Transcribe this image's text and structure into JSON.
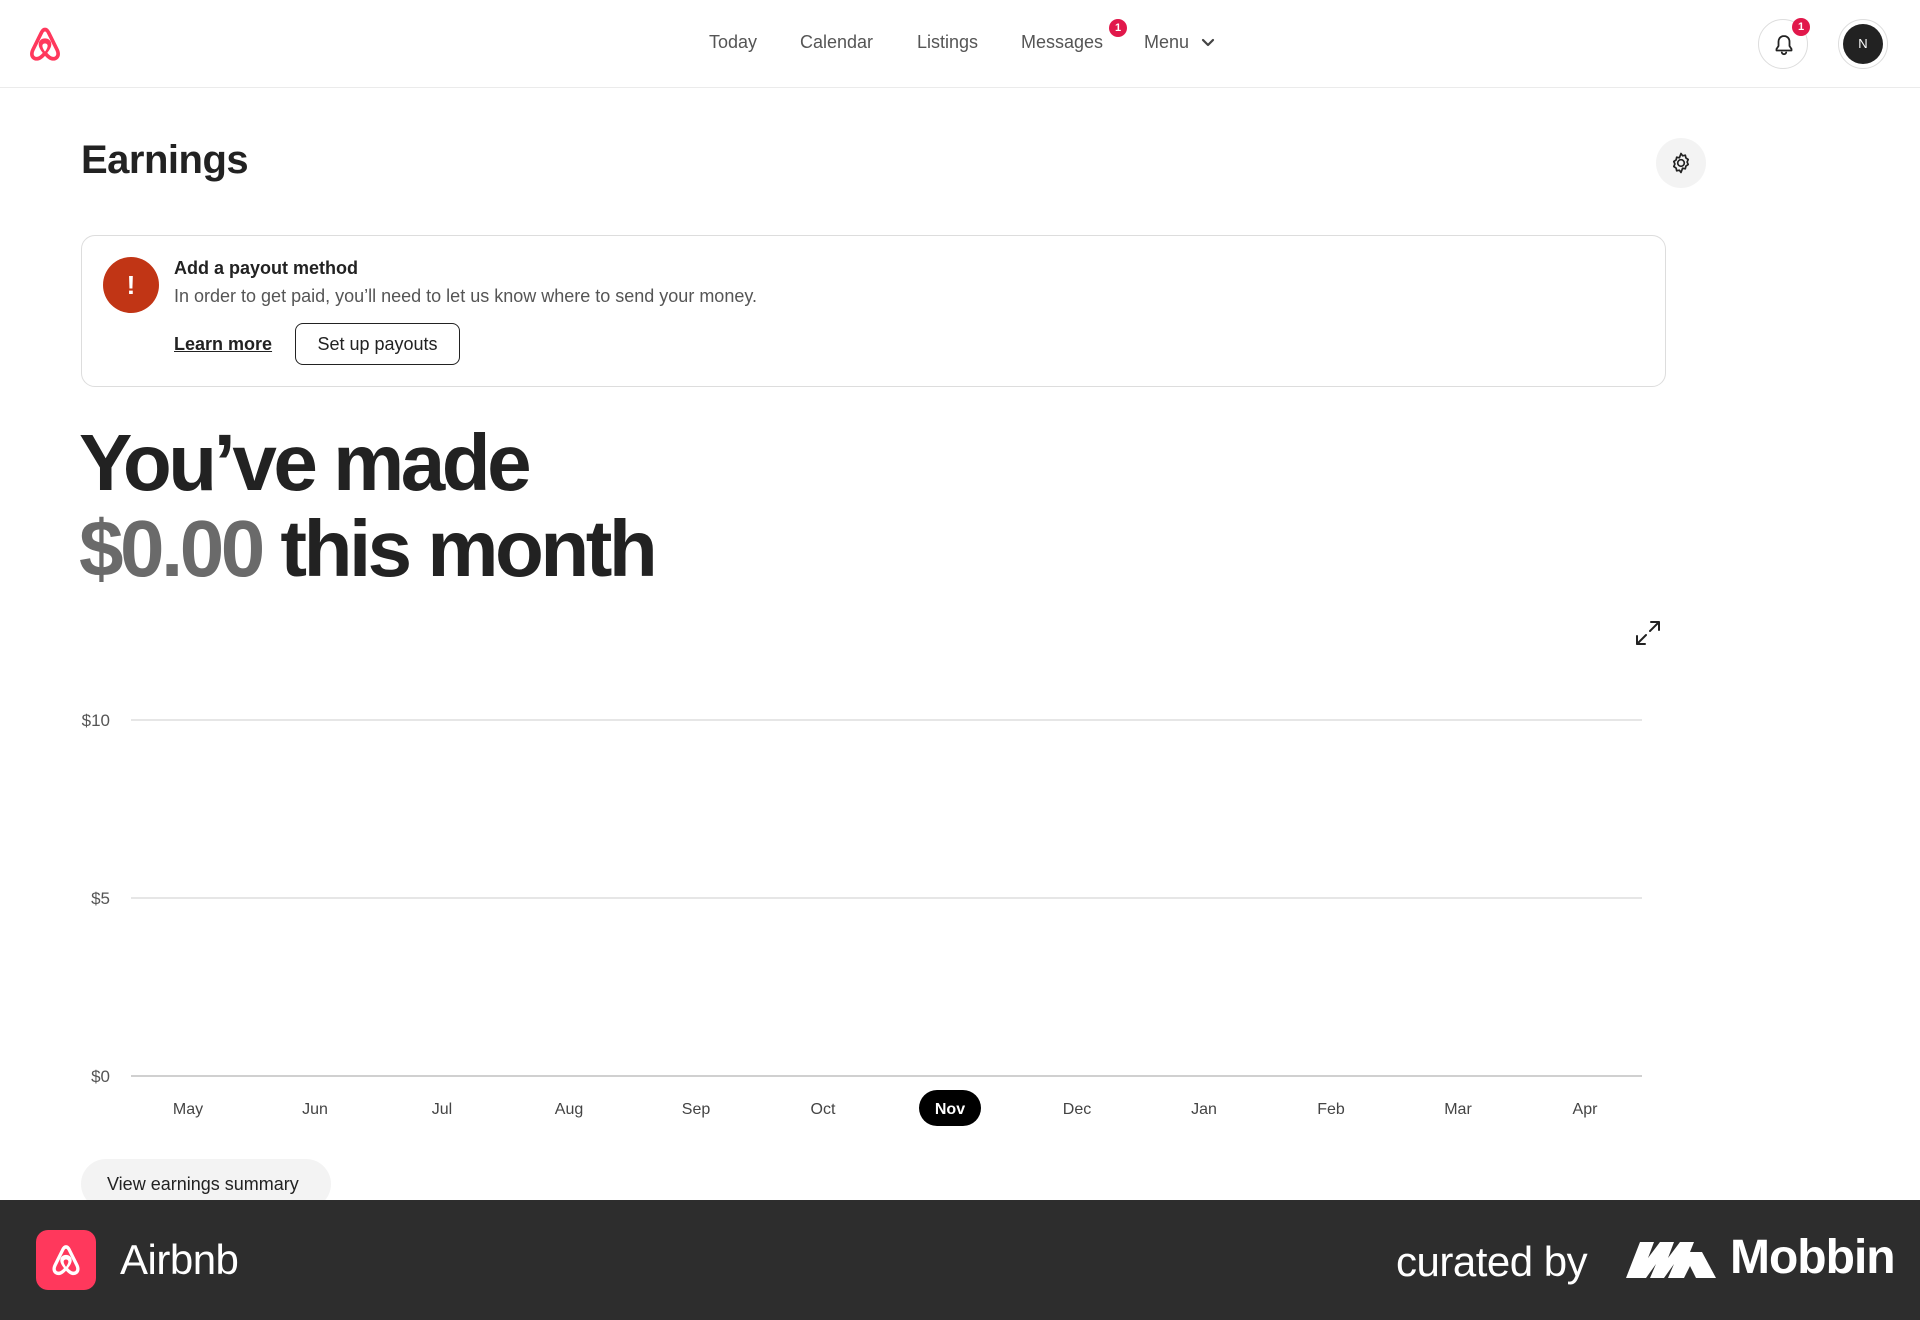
{
  "header": {
    "nav": [
      {
        "label": "Today"
      },
      {
        "label": "Calendar"
      },
      {
        "label": "Listings"
      },
      {
        "label": "Messages",
        "badge": "1"
      },
      {
        "label": "Menu"
      }
    ],
    "notifications_badge": "1",
    "avatar_initial": "N"
  },
  "page": {
    "title": "Earnings"
  },
  "payout_alert": {
    "icon_glyph": "!",
    "title": "Add a payout method",
    "description": "In order to get paid, you’ll need to let us know where to send your money.",
    "learn_more_label": "Learn more",
    "setup_label": "Set up payouts"
  },
  "headline": {
    "line1": "You’ve made",
    "amount": "$0.00",
    "line2_suffix": " this month"
  },
  "chart_data": {
    "type": "bar",
    "categories": [
      "May",
      "Jun",
      "Jul",
      "Aug",
      "Sep",
      "Oct",
      "Nov",
      "Dec",
      "Jan",
      "Feb",
      "Mar",
      "Apr"
    ],
    "values": [
      0,
      0,
      0,
      0,
      0,
      0,
      0,
      0,
      0,
      0,
      0,
      0
    ],
    "selected_category": "Nov",
    "yticks": [
      "$0",
      "$5",
      "$10"
    ],
    "ytick_values": [
      0,
      5,
      10
    ],
    "ylim": [
      0,
      10
    ],
    "grid": true,
    "title": "",
    "xlabel": "",
    "ylabel": ""
  },
  "summary_button_label": "View earnings summary",
  "footer": {
    "app_name": "Airbnb",
    "curated_by": "curated by",
    "brand": "Mobbin"
  },
  "colors": {
    "brand": "#ff385c",
    "badge": "#e1184b",
    "alert": "#c13515",
    "footer_bg": "#2d2d2d"
  }
}
